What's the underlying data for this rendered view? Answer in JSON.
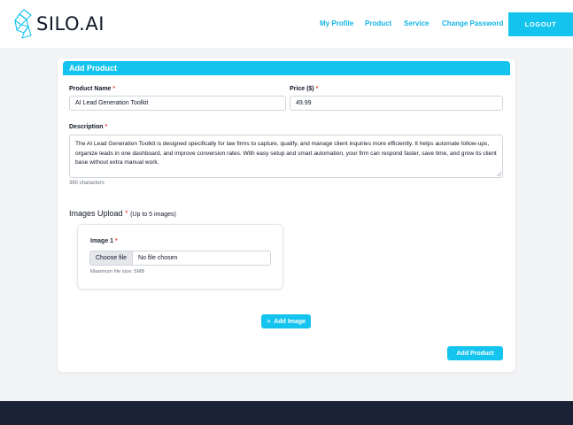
{
  "header": {
    "logo_text": "SILO.AI",
    "nav": [
      "My Profile",
      "Product",
      "Service",
      "Change Password"
    ],
    "logout_label": "LOGOUT"
  },
  "form": {
    "title": "Add Product",
    "product_name_label": "Product Name",
    "product_name_value": "AI Lead Generation Toolkit",
    "price_label": "Price ($)",
    "price_value": "49.99",
    "description_label": "Description",
    "description_value": "The AI Lead Generation Toolkit is designed specifically for law firms to capture, qualify, and manage client inquiries more efficiently. It helps automate follow-ups, organize leads in one dashboard, and improve conversion rates. With easy setup and smart automation, your firm can respond faster, save time, and grow its client base without extra manual work.",
    "char_count": "360 characters",
    "required_mark": "*",
    "images_title": "Images Upload",
    "images_note": "(Up to 5 images)",
    "image1_label": "Image 1",
    "choose_file_label": "Choose file",
    "no_file_label": "No file chosen",
    "file_hint": "Maximum file size: 5MB",
    "add_image_label": "Add Image",
    "add_product_label": "Add Product"
  },
  "colors": {
    "accent": "#14c4ee",
    "nav_text": "#13b5e6",
    "required": "#ef4444",
    "footer": "#1a2235"
  }
}
